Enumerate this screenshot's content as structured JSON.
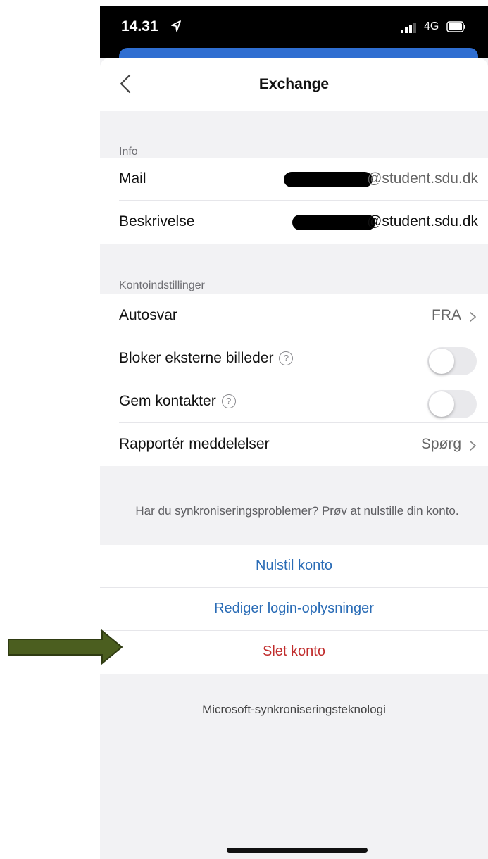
{
  "status_bar": {
    "time": "14.31",
    "network": "4G"
  },
  "nav": {
    "title": "Exchange"
  },
  "info": {
    "header": "Info",
    "rows": [
      {
        "label": "Mail",
        "value": "@student.sdu.dk"
      },
      {
        "label": "Beskrivelse",
        "value": "@student.sdu.dk"
      }
    ]
  },
  "account_settings": {
    "header": "Kontoindstillinger",
    "autoreply": {
      "label": "Autosvar",
      "value": "FRA"
    },
    "block_images": {
      "label": "Bloker eksterne billeder",
      "enabled": false
    },
    "save_contacts": {
      "label": "Gem kontakter",
      "enabled": false
    },
    "report_messages": {
      "label": "Rapportér meddelelser",
      "value": "Spørg"
    }
  },
  "sync_note": "Har du synkroniseringsproblemer? Prøv at nulstille din konto.",
  "actions": {
    "reset": "Nulstil konto",
    "edit_login": "Rediger login-oplysninger",
    "delete": "Slet konto"
  },
  "footer": "Microsoft-synkroniseringsteknologi",
  "colors": {
    "accent_blue": "#2a6cb6",
    "danger_red": "#c02c2c",
    "arrow_green": "#4b5e1f"
  }
}
